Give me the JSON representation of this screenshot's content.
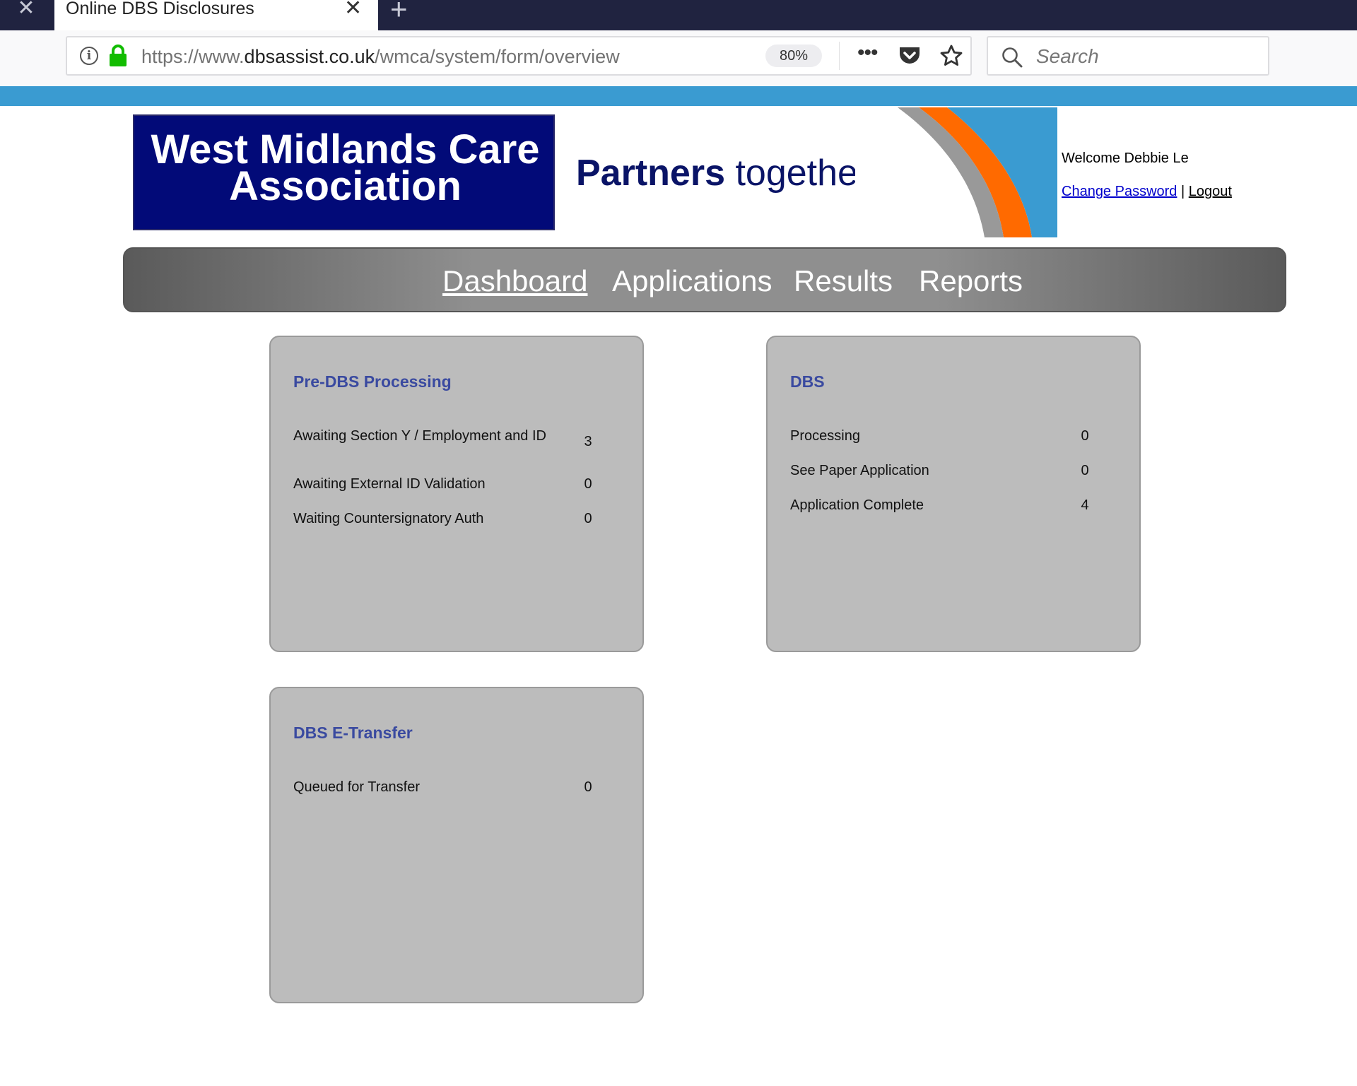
{
  "browser": {
    "tab_title": "Online DBS Disclosures",
    "tab_close": "✕",
    "prev_tab_close": "✕",
    "new_tab": "+",
    "url_prefix": "https://www.",
    "url_domain": "dbsassist.co.uk",
    "url_path": "/wmca/system/form/overview",
    "zoom": "80%",
    "more_icon": "•••",
    "search_placeholder": "Search"
  },
  "header": {
    "logo_line1": "West Midlands Care",
    "logo_line2": "Association",
    "tagline_bold": "Partners",
    "tagline_rest": " together",
    "welcome": "Welcome Debbie Le",
    "change_password": "Change Password",
    "separator": " | ",
    "logout": "Logout",
    "swoosh_colors": [
      "#3a9bd1",
      "#ff6a00",
      "#999999"
    ]
  },
  "nav": {
    "items": [
      {
        "label": "Dashboard",
        "active": true
      },
      {
        "label": "Applications",
        "active": false
      },
      {
        "label": "Results",
        "active": false
      },
      {
        "label": "Reports",
        "active": false
      }
    ]
  },
  "panels": {
    "pre_dbs": {
      "title": "Pre-DBS Processing",
      "rows": [
        {
          "label": "Awaiting Section Y / Employment and ID",
          "value": "3"
        },
        {
          "label": "Awaiting External ID Validation",
          "value": "0"
        },
        {
          "label": "Waiting Countersignatory Auth",
          "value": "0"
        }
      ]
    },
    "dbs": {
      "title": "DBS",
      "rows": [
        {
          "label": "Processing",
          "value": "0"
        },
        {
          "label": "See Paper Application",
          "value": "0"
        },
        {
          "label": "Application Complete",
          "value": "4"
        }
      ]
    },
    "e_transfer": {
      "title": "DBS E-Transfer",
      "rows": [
        {
          "label": "Queued for Transfer",
          "value": "0"
        }
      ]
    }
  }
}
